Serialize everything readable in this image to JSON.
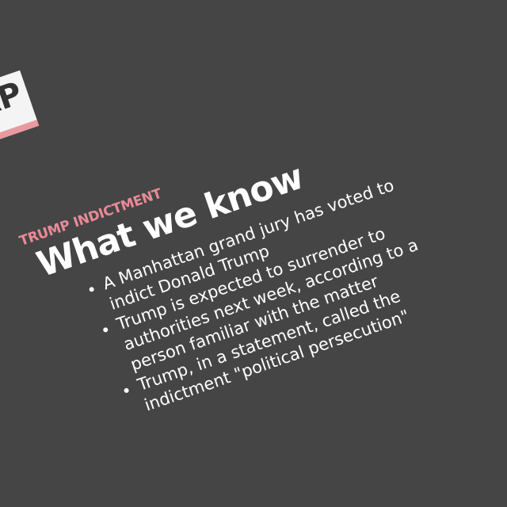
{
  "logo": {
    "text": "AP",
    "accent": "#e89aa0"
  },
  "card": {
    "label": "TRUMP INDICTMENT",
    "title": "What we know",
    "bullets": [
      "A Manhattan grand jury has voted to indict Donald Trump",
      "Trump is expected to surrender to authorities next week, according to a person familiar with the matter",
      "Trump, in a statement, called the indictment \"political persecution\""
    ]
  },
  "colors": {
    "background": "#454545",
    "label": "#e98a96",
    "text": "#ffffff"
  }
}
